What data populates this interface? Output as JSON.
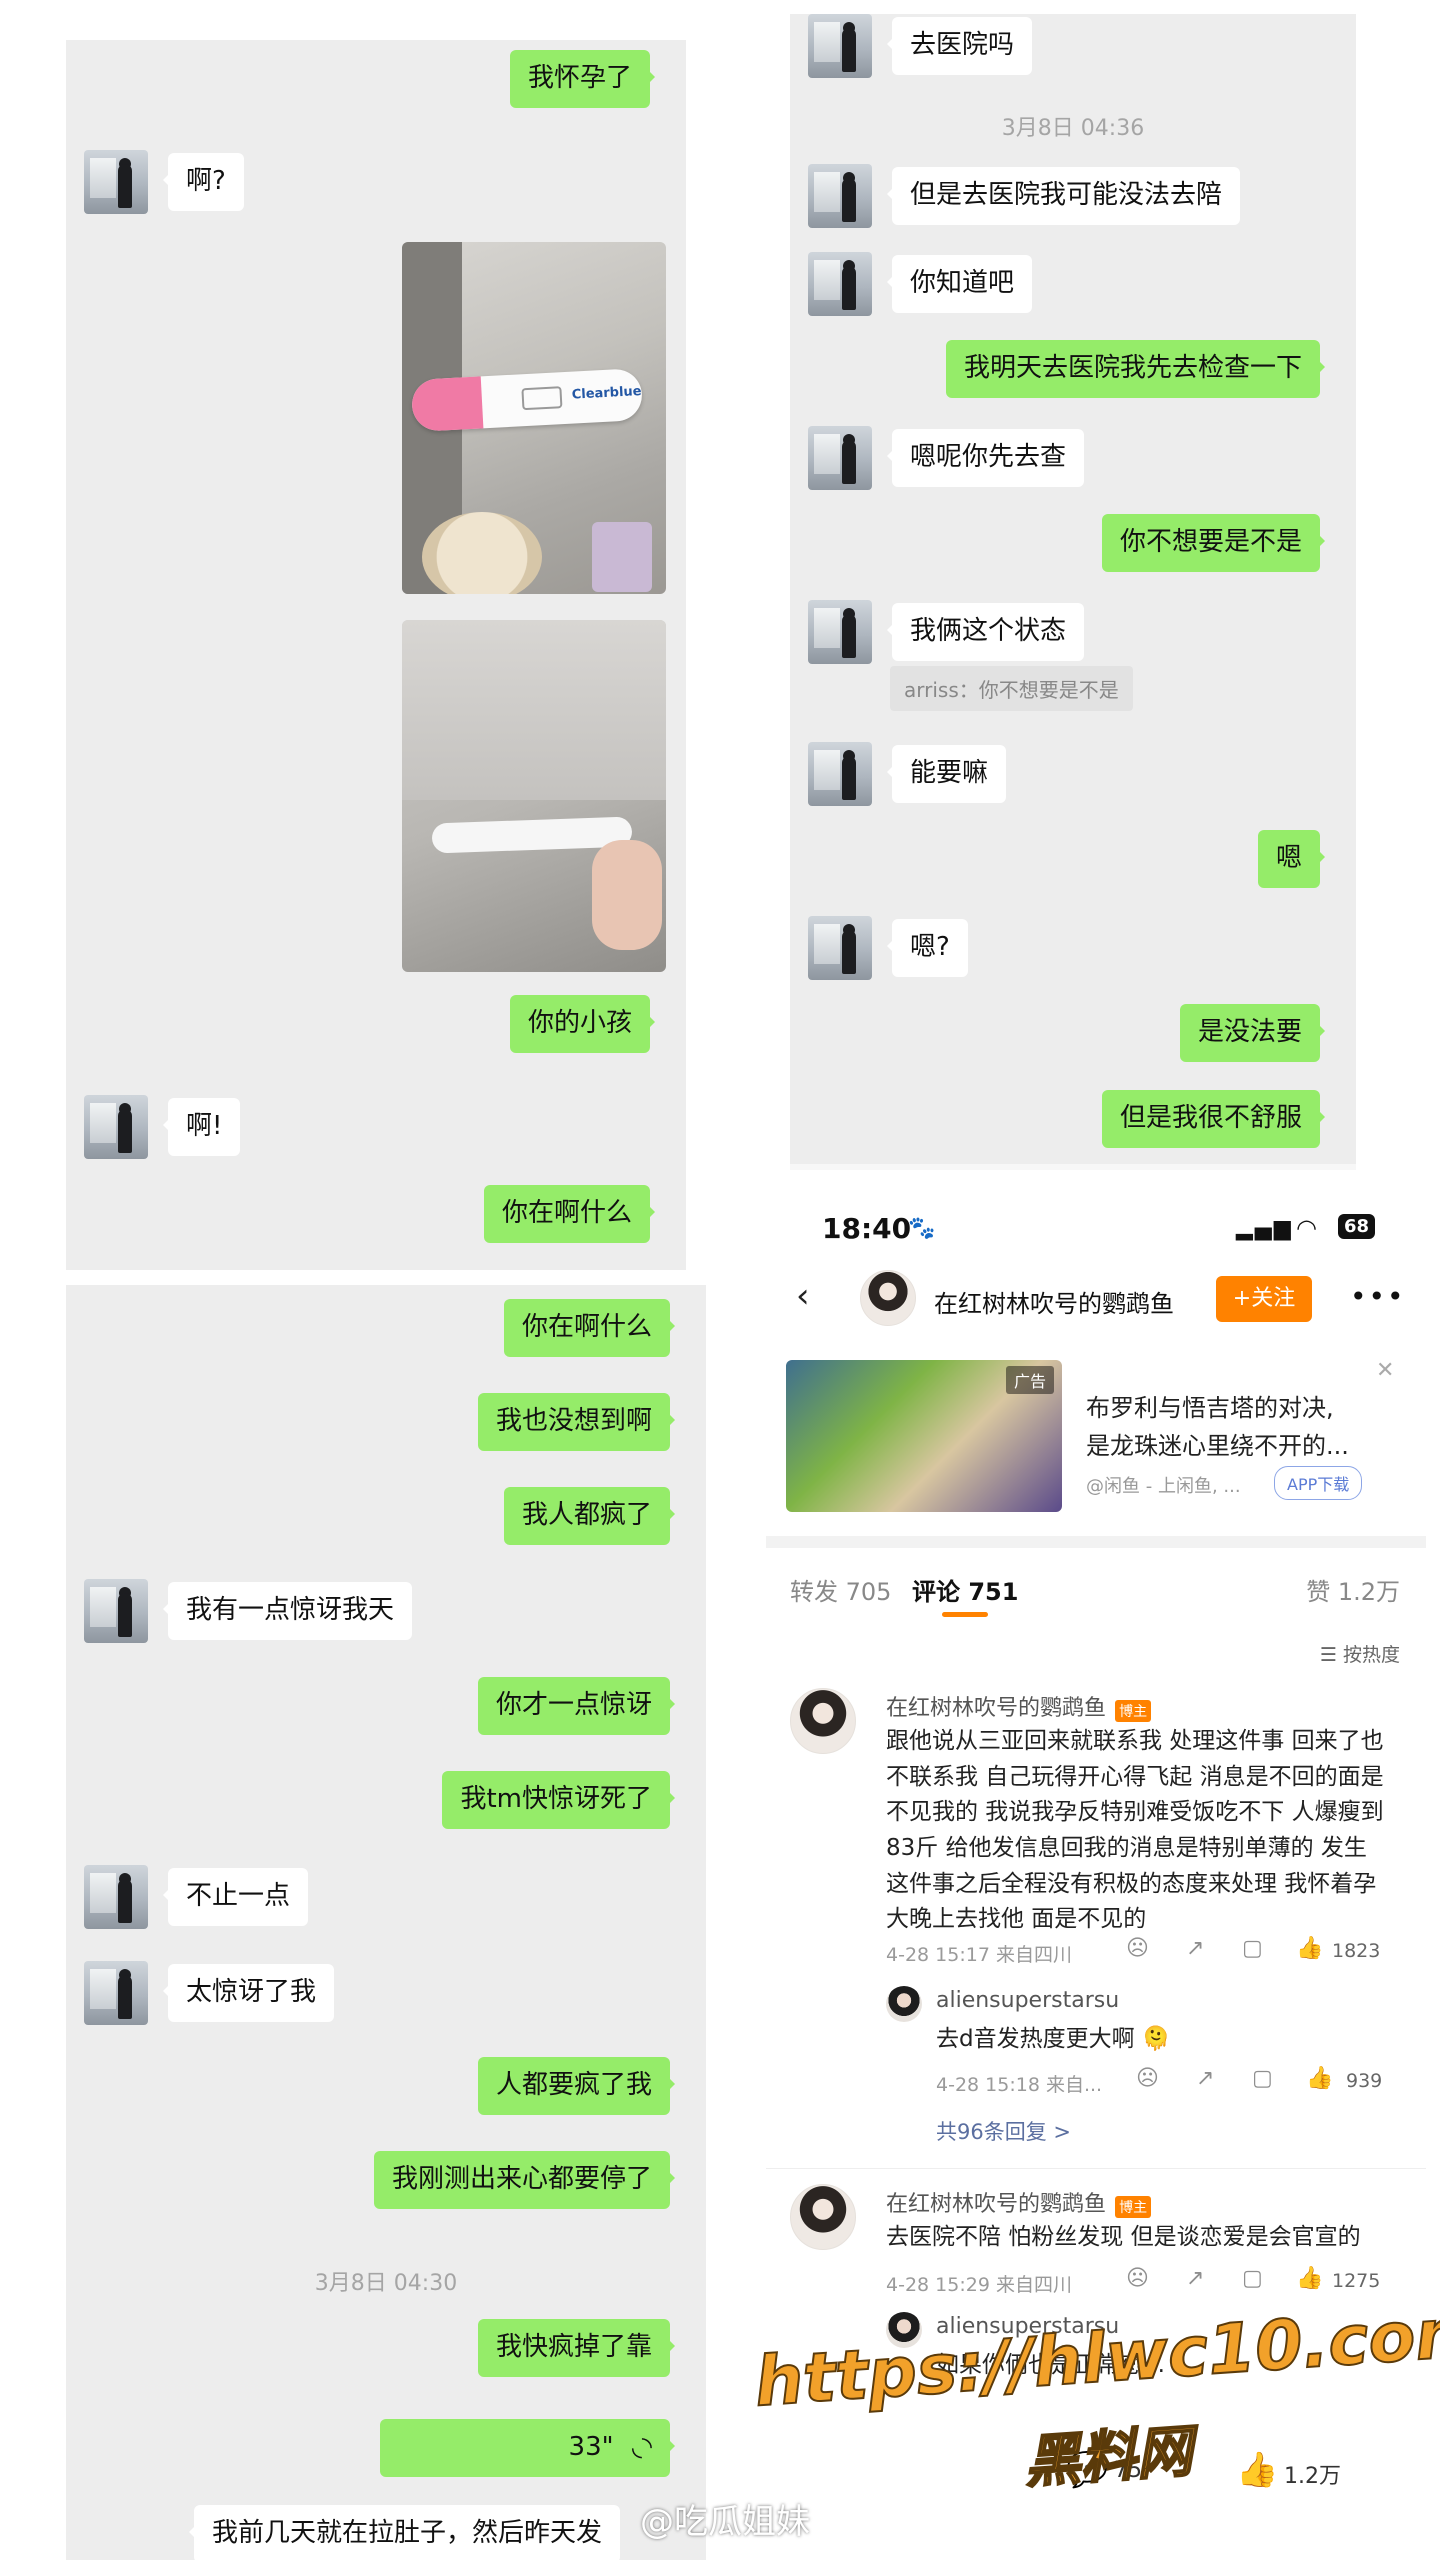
{
  "chat1": {
    "items": [
      {
        "side": "right",
        "text": "我怀孕了"
      },
      {
        "side": "left",
        "text": "啊?"
      },
      {
        "side": "right",
        "text": "你的小孩"
      },
      {
        "side": "left",
        "text": "啊!"
      },
      {
        "side": "right",
        "text": "你在啊什么"
      }
    ],
    "photo_label": "Clearblue"
  },
  "chat2": {
    "items": [
      {
        "side": "right",
        "text": "你在啊什么"
      },
      {
        "side": "right",
        "text": "我也没想到啊"
      },
      {
        "side": "right",
        "text": "我人都疯了"
      },
      {
        "side": "left",
        "text": "我有一点惊讶我天"
      },
      {
        "side": "right",
        "text": "你才一点惊讶"
      },
      {
        "side": "right",
        "text": "我tm快惊讶死了"
      },
      {
        "side": "left",
        "text": "不止一点"
      },
      {
        "side": "left",
        "text": "太惊讶了我"
      },
      {
        "side": "right",
        "text": "人都要疯了我"
      },
      {
        "side": "right",
        "text": "我刚测出来心都要停了"
      },
      {
        "side": "right",
        "text": "我快疯掉了靠"
      },
      {
        "side": "right",
        "text": "33\""
      },
      {
        "side": "left",
        "text": "我前几天就在拉肚子，然后昨天发"
      }
    ],
    "timestamp": "3月8日 04:30"
  },
  "chat3": {
    "items": [
      {
        "side": "left",
        "text": "去医院吗"
      },
      {
        "side": "left",
        "text": "但是去医院我可能没法去陪"
      },
      {
        "side": "left",
        "text": "你知道吧"
      },
      {
        "side": "right",
        "text": "我明天去医院我先去检查一下"
      },
      {
        "side": "left",
        "text": "嗯呢你先去查"
      },
      {
        "side": "right",
        "text": "你不想要是不是"
      },
      {
        "side": "left",
        "text": "我俩这个状态"
      },
      {
        "side": "left",
        "text": "能要嘛"
      },
      {
        "side": "right",
        "text": "嗯"
      },
      {
        "side": "left",
        "text": "嗯?"
      },
      {
        "side": "right",
        "text": "是没法要"
      },
      {
        "side": "right",
        "text": "但是我很不舒服"
      }
    ],
    "timestamp": "3月8日 04:36",
    "quote": "arriss：你不想要是不是"
  },
  "social": {
    "status_time": "18:40",
    "battery": "68",
    "account_name": "在红树林吹号的鹦鹉鱼",
    "follow_label": "+关注",
    "ad": {
      "tag": "广告",
      "title_line1": "布罗利与悟吉塔的对决,",
      "title_line2": "是龙珠迷心里绕不开的...",
      "source": "@闲鱼 - 上闲鱼, ...",
      "download": "APP下载"
    },
    "tabs": {
      "repost": "转发 705",
      "comment": "评论 751",
      "like": "赞 1.2万"
    },
    "sort_label": "按热度",
    "comments": [
      {
        "author": "在红树林吹号的鹦鹉鱼",
        "badge": "博主",
        "text": "跟他说从三亚回来就联系我 处理这件事 回来了也不联系我 自己玩得开心得飞起 消息是不回的面是不见我的 我说我孕反特别难受饭吃不下 人爆瘦到83斤 给他发信息回我的消息是特别单薄的 发生这件事之后全程没有积极的态度来处理 我怀着孕大晚上去找他 面是不见的",
        "meta": "4-28 15:17 来自四川",
        "likes": "1823",
        "reply": {
          "author": "aliensuperstarsu",
          "text": "去d音发热度更大啊 🫠",
          "meta": "4-28 15:18 来自...",
          "likes": "939"
        },
        "more_replies": "共96条回复 >"
      },
      {
        "author": "在红树林吹号的鹦鹉鱼",
        "badge": "博主",
        "text": "去医院不陪 怕粉丝发现 但是谈恋爱是会官宣的",
        "meta": "4-28 15:29 来自四川",
        "likes": "1275",
        "reply": {
          "author": "aliensuperstarsu",
          "text": "如果你俩也是正常恋..."
        }
      }
    ],
    "bottom": {
      "comment_count": "75",
      "like_count": "1.2万"
    }
  },
  "watermarks": {
    "url": "https://hlwc10.com",
    "site": "黑料网",
    "weibo": "@吃瓜姐妹"
  },
  "colors": {
    "wechat_green": "#95ec69",
    "chat_bg": "#ededed",
    "weibo_orange": "#ff8200"
  }
}
